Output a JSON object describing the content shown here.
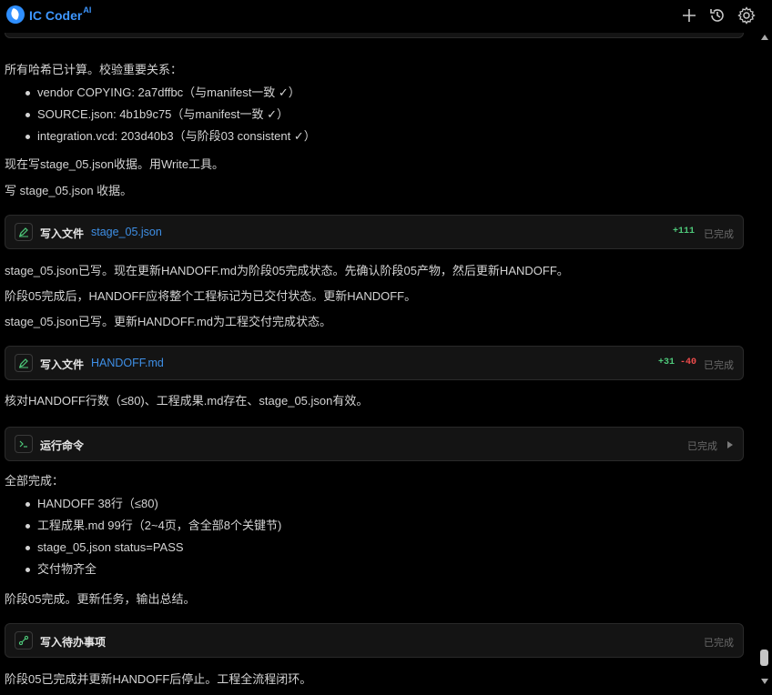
{
  "app": {
    "name": "IC Coder",
    "sup": "AI"
  },
  "header": {
    "new_icon": "plus-icon",
    "history_icon": "history-icon",
    "settings_icon": "gear-icon"
  },
  "colors": {
    "accent": "#3e8fe6",
    "added": "#4ec97a",
    "removed": "#f14c4c",
    "background": "#000000"
  },
  "messages": {
    "p1": "所有哈希已计算。校验重要关系：",
    "list1": [
      "vendor COPYING: 2a7dffbc（与manifest一致 ✓）",
      "SOURCE.json: 4b1b9c75（与manifest一致 ✓）",
      "integration.vcd: 203d40b3（与阶段03 consistent ✓）"
    ],
    "p2": "现在写stage_05.json收据。用Write工具。",
    "p3": "写 stage_05.json 收据。",
    "p4": "stage_05.json已写。现在更新HANDOFF.md为阶段05完成状态。先确认阶段05产物，然后更新HANDOFF。",
    "p5": "阶段05完成后，HANDOFF应将整个工程标记为已交付状态。更新HANDOFF。",
    "p6": "stage_05.json已写。更新HANDOFF.md为工程交付完成状态。",
    "p7": "核对HANDOFF行数（≤80)、工程成果.md存在、stage_05.json有效。",
    "p8": "全部完成：",
    "list2": [
      "HANDOFF 38行（≤80)",
      "工程成果.md 99行（2~4页，含全部8个关键节)",
      "stage_05.json status=PASS",
      "交付物齐全"
    ],
    "p9": "阶段05完成。更新任务，输出总结。",
    "p10": "阶段05已完成并更新HANDOFF后停止。工程全流程闭环。"
  },
  "cards": {
    "write1": {
      "title": "写入文件",
      "file": "stage_05.json",
      "added": "+111",
      "status": "已完成",
      "icon": "edit-icon"
    },
    "write2": {
      "title": "写入文件",
      "file": "HANDOFF.md",
      "added": "+31",
      "removed": "-40",
      "status": "已完成",
      "icon": "edit-icon"
    },
    "cmd": {
      "title": "运行命令",
      "status": "已完成",
      "icon": "terminal-icon"
    },
    "todo": {
      "title": "写入待办事项",
      "status": "已完成",
      "icon": "todo-icon"
    }
  }
}
